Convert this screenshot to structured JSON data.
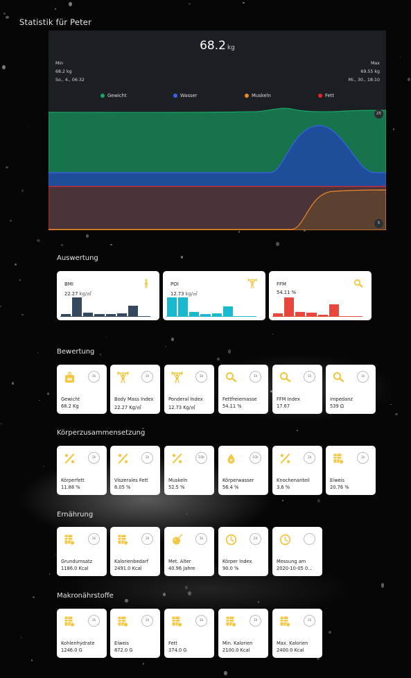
{
  "page_title": "Statistik für Peter",
  "chart": {
    "current_value": "68.2",
    "current_unit": "kg",
    "min": {
      "label": "Min",
      "value": "68.2 kg",
      "date": "So., 4., 06:32"
    },
    "max": {
      "label": "Max",
      "value": "69.55 kg",
      "date": "Mi., 30., 18:10"
    },
    "legend": [
      {
        "name": "Gewicht",
        "color": "#1aa564"
      },
      {
        "name": "Wasser",
        "color": "#3a63e8"
      },
      {
        "name": "Muskeln",
        "color": "#f0882a"
      },
      {
        "name": "Fett",
        "color": "#e8242e"
      }
    ],
    "axis_top": "25",
    "axis_bottom": "5"
  },
  "chart_data": {
    "type": "area",
    "series": [
      {
        "name": "Gewicht",
        "color": "#1aa564",
        "fill": "#16734c"
      },
      {
        "name": "Wasser",
        "color": "#3a63e8",
        "fill": "#1e4d99"
      },
      {
        "name": "Fett",
        "color": "#e8242e",
        "fill": "#4a3438"
      },
      {
        "name": "Muskeln",
        "color": "#f0882a",
        "fill": "#5c4030"
      }
    ],
    "y_ticks": [
      "25",
      "5"
    ]
  },
  "sections": {
    "evaluation": "Auswertung",
    "assessment": "Bewertung",
    "composition": "Körperzusammensetzung",
    "nutrition": "Ernährung",
    "macros": "Makronährstoffe"
  },
  "eval_cards": [
    {
      "label": "BMI",
      "value": "22.27",
      "unit": "kg/㎡",
      "color": "#34495e",
      "icon": "person-icon",
      "levels": [
        0.12,
        0.82,
        0.18,
        0.12,
        0.12,
        0.15,
        0.48,
        0.03
      ]
    },
    {
      "label": "POI",
      "value": "12.73",
      "unit": "kg/㎥",
      "color": "#1ab9d0",
      "icon": "weightlifter-icon",
      "levels": [
        0.82,
        0.82,
        0.22,
        0.12,
        0.15,
        0.45,
        0.03,
        0.0
      ]
    },
    {
      "label": "FFM",
      "value": "54.11 %",
      "unit": "",
      "color": "#e8473e",
      "icon": "magnifier-icon",
      "levels": [
        0.15,
        0.82,
        0.22,
        0.18,
        0.1,
        0.52,
        0.03,
        0.0
      ]
    }
  ],
  "assessment_tiles": [
    {
      "label": "Gewicht",
      "value": "68.2 Kg",
      "tag": "1k",
      "icon": "weight-icon"
    },
    {
      "label": "Body Mass Index",
      "value": "22.27 Kg/㎡",
      "tag": "1k",
      "icon": "weightlifter-icon"
    },
    {
      "label": "Ponderal Index",
      "value": "12.73 Kg/㎥",
      "tag": "1k",
      "icon": "weightlifter-icon"
    },
    {
      "label": "Fettfreiemasse",
      "value": "54.11 %",
      "tag": "1k",
      "icon": "magnifier-icon"
    },
    {
      "label": "FFM Index",
      "value": "17.67",
      "tag": "1k",
      "icon": "magnifier-icon"
    },
    {
      "label": "Impedanz",
      "value": "539 Ω",
      "tag": "1k",
      "icon": "magnifier-icon"
    }
  ],
  "composition_tiles": [
    {
      "label": "Körperfett",
      "value": "11.88 %",
      "tag": "1k",
      "icon": "percent-icon"
    },
    {
      "label": "Viszerales Fett",
      "value": "6.05 %",
      "tag": "1k",
      "icon": "percent-icon"
    },
    {
      "label": "Muskeln",
      "value": "52.5 %",
      "tag": "10k",
      "icon": "percent-icon"
    },
    {
      "label": "Körperwasser",
      "value": "56.4 %",
      "tag": "10k",
      "icon": "droplet-icon"
    },
    {
      "label": "Knochenanteil",
      "value": "3.6 %",
      "tag": "1k",
      "icon": "percent-icon"
    },
    {
      "label": "Eiweis",
      "value": "20.76 %",
      "tag": "1k",
      "icon": "table-icon"
    }
  ],
  "nutrition_tiles": [
    {
      "label": "Grundumsatz",
      "value": "1186.0 Kcal",
      "tag": "1k",
      "icon": "table-icon"
    },
    {
      "label": "Kalorienbedarf",
      "value": "2491.0 Kcal",
      "tag": "1k",
      "icon": "table-icon"
    },
    {
      "label": "Met. Alter",
      "value": "40.96 Jahre",
      "tag": "1k",
      "icon": "bomb-icon"
    },
    {
      "label": "Körper Index",
      "value": "90.0 %",
      "tag": "2d",
      "icon": "clock-icon"
    },
    {
      "label": "Messung am",
      "value": "2020-10-05 0...",
      "tag": "",
      "icon": "clock-icon"
    }
  ],
  "macro_tiles": [
    {
      "label": "Kohlenhydrate",
      "value": "1246.0 G",
      "tag": "1k",
      "icon": "table-icon"
    },
    {
      "label": "Eiweis",
      "value": "872.0 G",
      "tag": "1k",
      "icon": "table-icon"
    },
    {
      "label": "Fett",
      "value": "374.0 G",
      "tag": "1k",
      "icon": "table-icon"
    },
    {
      "label": "Min. Kalorien",
      "value": "2100.0 Kcal",
      "tag": "1k",
      "icon": "table-icon"
    },
    {
      "label": "Max. Kalorien",
      "value": "2400.0 Kcal",
      "tag": "1k",
      "icon": "table-icon"
    }
  ]
}
